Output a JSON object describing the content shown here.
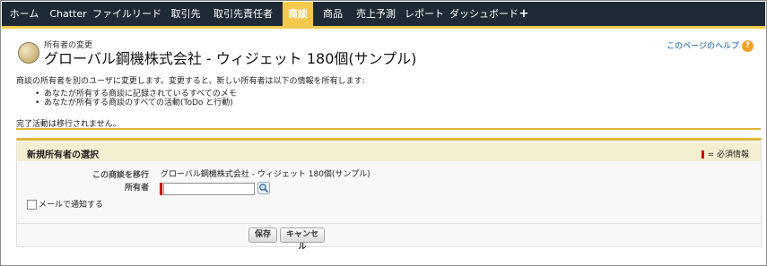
{
  "tabs": [
    {
      "label": "ホーム",
      "active": false
    },
    {
      "label": "Chatter",
      "active": false
    },
    {
      "label": "ファイル",
      "active": false
    },
    {
      "label": "リード",
      "active": false
    },
    {
      "label": "取引先",
      "active": false
    },
    {
      "label": "取引先責任者",
      "active": false
    },
    {
      "label": "商談",
      "active": true
    },
    {
      "label": "商品",
      "active": false
    },
    {
      "label": "売上予測",
      "active": false
    },
    {
      "label": "レポート",
      "active": false
    },
    {
      "label": "ダッシュボード",
      "active": false
    },
    {
      "label": "+",
      "active": false
    }
  ],
  "header": {
    "type_label": "所有者の変更",
    "title": "グローバル鋼機株式会社 - ウィジェット 180個(サンプル)",
    "help_link": "このページのヘルプ",
    "help_icon": "?"
  },
  "description": {
    "intro": "商談の所有者を別のユーザに変更します。変更すると、新しい所有者は以下の情報を所有します:",
    "bullets": [
      "あなたが所有する商談に記録されているすべてのメモ",
      "あなたが所有する商談のすべての活動(ToDo と行動)"
    ],
    "note": "完了活動は移行されません。"
  },
  "section": {
    "title": "新規所有者の選択",
    "required_legend": "= 必須情報",
    "transfer_label": "この商談を移行",
    "transfer_value": "グローバル鋼機株式会社 - ウィジェット 180個(サンプル)",
    "owner_label": "所有者",
    "owner_value": "",
    "notify_label": "メールで通知する",
    "notify_checked": false
  },
  "buttons": {
    "save": "保存",
    "cancel": "キャンセル"
  },
  "colors": {
    "tab_bar": "#1e2a35",
    "active_tab": "#f3c94c",
    "accent_line": "#e0b63a",
    "required": "#cc0000",
    "link": "#015ba7"
  },
  "icons": [
    "opportunity-icon",
    "help-icon",
    "lookup-search-icon",
    "plus-icon"
  ]
}
